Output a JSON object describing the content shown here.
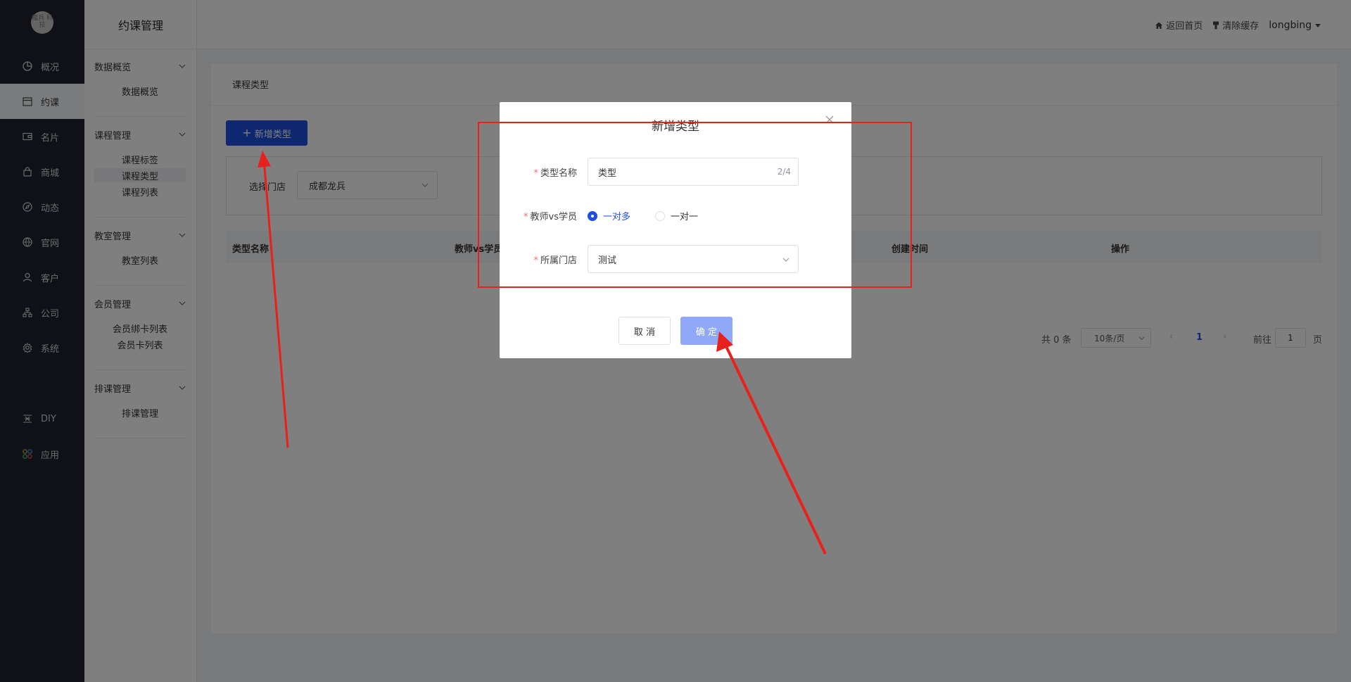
{
  "nav": {
    "logo_text": "龍兵\n科技",
    "items": [
      {
        "label": "概况",
        "icon": "pie-chart-icon"
      },
      {
        "label": "约课",
        "icon": "calendar-icon"
      },
      {
        "label": "名片",
        "icon": "card-icon"
      },
      {
        "label": "商城",
        "icon": "shopping-bag-icon"
      },
      {
        "label": "动态",
        "icon": "compass-icon"
      },
      {
        "label": "官网",
        "icon": "globe-icon"
      },
      {
        "label": "客户",
        "icon": "user-icon"
      },
      {
        "label": "公司",
        "icon": "org-chart-icon"
      },
      {
        "label": "系统",
        "icon": "gear-icon"
      },
      {
        "label": "DIY",
        "icon": "diy-icon"
      },
      {
        "label": "应用",
        "icon": "apps-icon"
      }
    ]
  },
  "subnav": {
    "title": "约课管理",
    "groups": [
      {
        "title": "数据概览",
        "links": [
          "数据概览"
        ]
      },
      {
        "title": "课程管理",
        "links": [
          "课程标签",
          "课程类型",
          "课程列表"
        ]
      },
      {
        "title": "教室管理",
        "links": [
          "教室列表"
        ]
      },
      {
        "title": "会员管理",
        "links": [
          "会员绑卡列表",
          "会员卡列表"
        ]
      },
      {
        "title": "排课管理",
        "links": [
          "排课管理"
        ]
      }
    ]
  },
  "topbar": {
    "home": "返回首页",
    "clear_cache": "清除缓存",
    "user": "longbing"
  },
  "panel": {
    "title": "课程类型",
    "add_button": "新增类型",
    "filter_label": "选择门店",
    "filter_value": "成都龙兵",
    "columns": [
      "类型名称",
      "教师vs学员",
      "创建时间",
      "操作"
    ],
    "pager": {
      "total": "共 0 条",
      "page_size": "10条/页",
      "current": "1",
      "goto_prefix": "前往",
      "goto_value": "1",
      "goto_suffix": "页"
    }
  },
  "dialog": {
    "title": "新增类型",
    "name_label": "类型名称",
    "name_value": "类型",
    "name_count": "2/4",
    "ratio_label": "教师vs学员",
    "ratio_options": [
      "一对多",
      "一对一"
    ],
    "ratio_selected": "一对多",
    "store_label": "所属门店",
    "store_value": "测试",
    "cancel": "取 消",
    "confirm": "确 定"
  },
  "colors": {
    "primary": "#1e4fe0",
    "confirm_disabled": "#8fa8f8",
    "annotation": "#e8211c",
    "nav_bg": "#1e222d"
  }
}
